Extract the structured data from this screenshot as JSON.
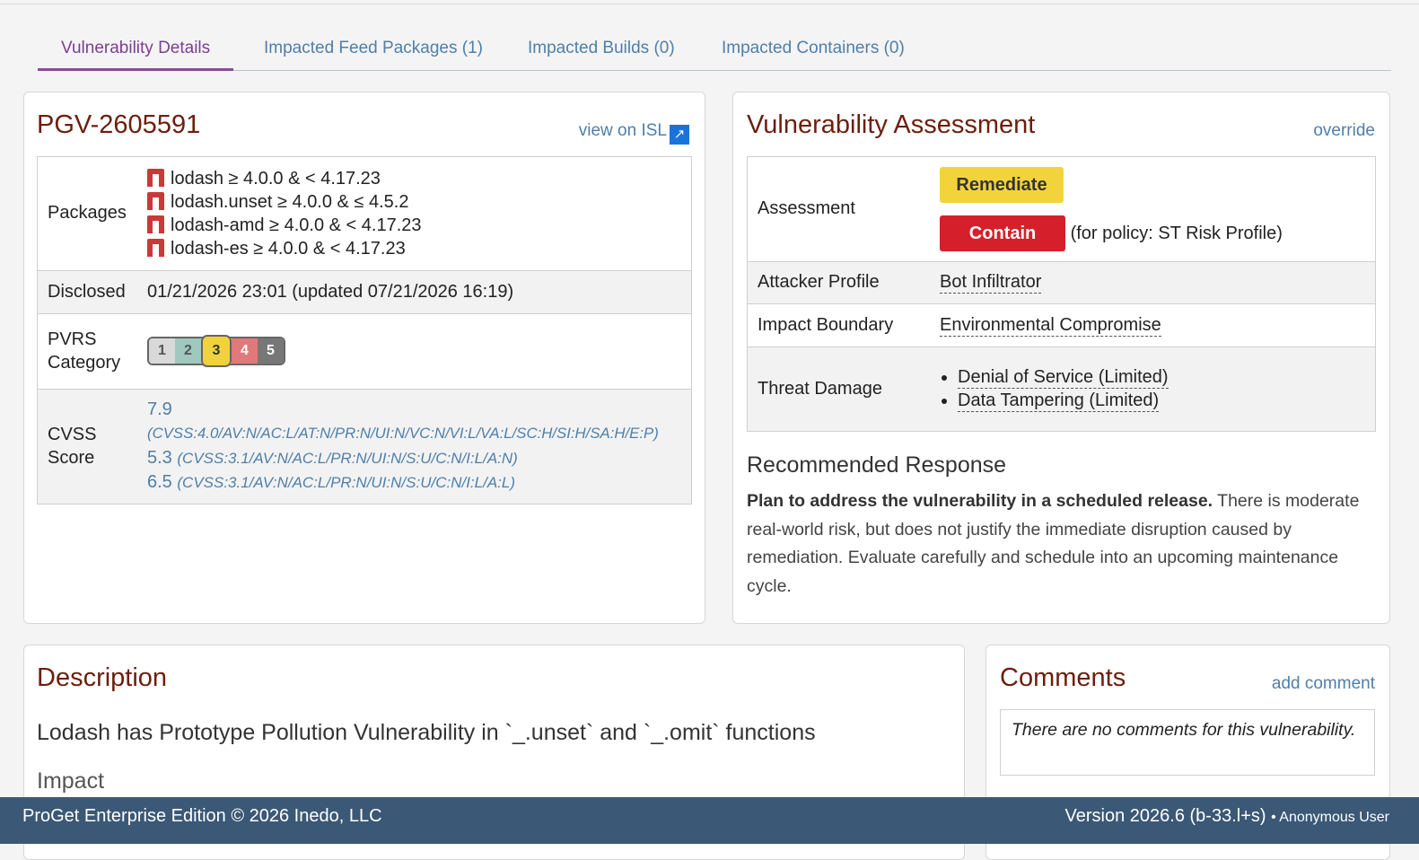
{
  "tabs": [
    {
      "label": "Vulnerability Details",
      "active": true
    },
    {
      "label": "Impacted Feed Packages (1)",
      "active": false
    },
    {
      "label": "Impacted Builds (0)",
      "active": false
    },
    {
      "label": "Impacted Containers (0)",
      "active": false
    }
  ],
  "vulnerability": {
    "id": "PGV-2605591",
    "view_link": "view on ISL",
    "labels": {
      "packages": "Packages",
      "disclosed": "Disclosed",
      "pvrs_line1": "PVRS",
      "pvrs_line2": "Category",
      "cvss_line1": "CVSS",
      "cvss_line2": "Score"
    },
    "packages": [
      "lodash ≥ 4.0.0 & < 4.17.23",
      "lodash.unset ≥ 4.0.0 & ≤ 4.5.2",
      "lodash-amd ≥ 4.0.0 & < 4.17.23",
      "lodash-es ≥ 4.0.0 & < 4.17.23"
    ],
    "package_icon": "npm-icon",
    "disclosed": "01/21/2026 23:01 (updated 07/21/2026 16:19)",
    "pvrs": {
      "levels": [
        "1",
        "2",
        "3",
        "4",
        "5"
      ],
      "selected": "3"
    },
    "cvss": [
      {
        "score": "7.9",
        "vector": "(CVSS:4.0/AV:N/AC:L/AT:N/PR:N/UI:N/VC:N/VI:L/VA:L/SC:H/SI:H/SA:H/E:P)"
      },
      {
        "score": "5.3",
        "vector": "(CVSS:3.1/AV:N/AC:L/PR:N/UI:N/S:U/C:N/I:L/A:N)"
      },
      {
        "score": "6.5",
        "vector": "(CVSS:3.1/AV:N/AC:L/PR:N/UI:N/S:U/C:N/I:L/A:L)"
      }
    ]
  },
  "assessment": {
    "title": "Vulnerability Assessment",
    "override_link": "override",
    "labels": {
      "assessment": "Assessment",
      "attacker_profile": "Attacker Profile",
      "impact_boundary": "Impact Boundary",
      "threat_damage": "Threat Damage"
    },
    "remediate_label": "Remediate",
    "contain_label": "Contain",
    "policy_note": "(for policy: ST Risk Profile)",
    "attacker_profile": "Bot Infiltrator",
    "impact_boundary": "Environmental Compromise",
    "threat_damage": [
      "Denial of Service (Limited)",
      "Data Tampering (Limited)"
    ],
    "colors": {
      "remediate": "#f2d43a",
      "contain": "#d5202b"
    }
  },
  "recommended": {
    "title": "Recommended Response",
    "bold": "Plan to address the vulnerability in a scheduled release.",
    "text": " There is moderate real-world risk, but does not justify the immediate disruption caused by remediation. Evaluate carefully and schedule into an upcoming maintenance cycle."
  },
  "description": {
    "title": "Description",
    "headline": "Lodash has Prototype Pollution Vulnerability in `_.unset` and `_.omit` functions",
    "subheading": "Impact"
  },
  "comments": {
    "title": "Comments",
    "add_link": "add comment",
    "empty_text": "There are no comments for this vulnerability."
  },
  "footer": {
    "left": "ProGet Enterprise Edition © 2026 Inedo, LLC",
    "version": "Version 2026.6 (b-33.l+s)",
    "user": "• Anonymous User"
  }
}
